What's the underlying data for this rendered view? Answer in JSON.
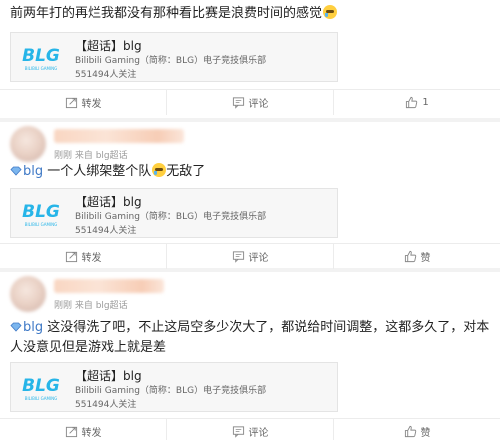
{
  "posts": [
    {
      "meta": "",
      "text": "前两年打的再烂我都没有那种看比赛是浪费时间的感觉",
      "card": {
        "title": "【超话】blg",
        "desc": "Bilibili Gaming（简称：BLG）电子竞技俱乐部",
        "followers": "551494人关注"
      },
      "actions": {
        "repost": "转发",
        "comment": "评论",
        "like": "1"
      }
    },
    {
      "meta": "刚刚 来自 blg超话",
      "topic": "blg",
      "text_before_emoji": " 一个人绑架整个队",
      "text_after_emoji": "无敌了",
      "card": {
        "title": "【超话】blg",
        "desc": "Bilibili Gaming（简称：BLG）电子竞技俱乐部",
        "followers": "551494人关注"
      },
      "actions": {
        "repost": "转发",
        "comment": "评论",
        "like": "赞"
      }
    },
    {
      "meta": "刚刚 来自 blg超话",
      "topic": "blg",
      "text": " 这没得洗了吧，不止这局空多少次大了，都说给时间调整，这都多久了，对本人没意见但是游戏上就是差",
      "card": {
        "title": "【超话】blg",
        "desc": "Bilibili Gaming（简称：BLG）电子竞技俱乐部",
        "followers": "551494人关注"
      },
      "actions": {
        "repost": "转发",
        "comment": "评论",
        "like": "赞"
      }
    }
  ],
  "logo": {
    "text": "BLG",
    "subtext": "BILIBILI GAMING"
  },
  "colors": {
    "topic": "#3f79c6",
    "logo": "#27b5e8",
    "muted": "#9a9a9a"
  },
  "icons": {
    "repost": "repost-icon",
    "comment": "comment-icon",
    "like": "thumbs-up-icon",
    "topic": "diamond-icon",
    "emoji": "emoji-icon"
  }
}
